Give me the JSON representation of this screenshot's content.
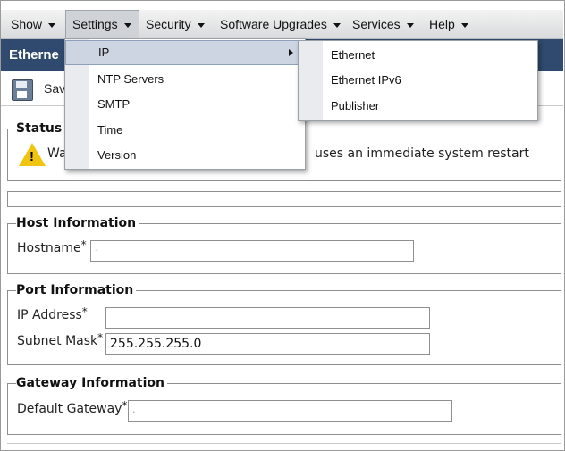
{
  "menubar": {
    "items": [
      {
        "label": "Show"
      },
      {
        "label": "Settings"
      },
      {
        "label": "Security"
      },
      {
        "label": "Software Upgrades"
      },
      {
        "label": "Services"
      },
      {
        "label": "Help"
      }
    ]
  },
  "title": "Etherne",
  "toolbar": {
    "save_label": "Sav"
  },
  "settings_menu": {
    "items": [
      "IP",
      "NTP Servers",
      "SMTP",
      "Time",
      "Version"
    ]
  },
  "ip_submenu": {
    "items": [
      "Ethernet",
      "Ethernet IPv6",
      "Publisher"
    ]
  },
  "status": {
    "legend": "Status",
    "warning_prefix": "Wa",
    "warning_suffix": "uses an immediate system restart"
  },
  "host": {
    "legend": "Host Information",
    "hostname_label": "Hostname",
    "hostname_value": "-"
  },
  "port": {
    "legend": "Port Information",
    "ip_label": "IP Address",
    "ip_value": "",
    "subnet_label": "Subnet Mask",
    "subnet_value": "255.255.255.0"
  },
  "gateway": {
    "legend": "Gateway Information",
    "gateway_label": "Default Gateway",
    "gateway_value": "."
  },
  "required_marker": "*",
  "colors": {
    "title_bar": "#2f4a6e",
    "menu_highlight": "#cdd5e3",
    "warning": "#f1c40f"
  }
}
